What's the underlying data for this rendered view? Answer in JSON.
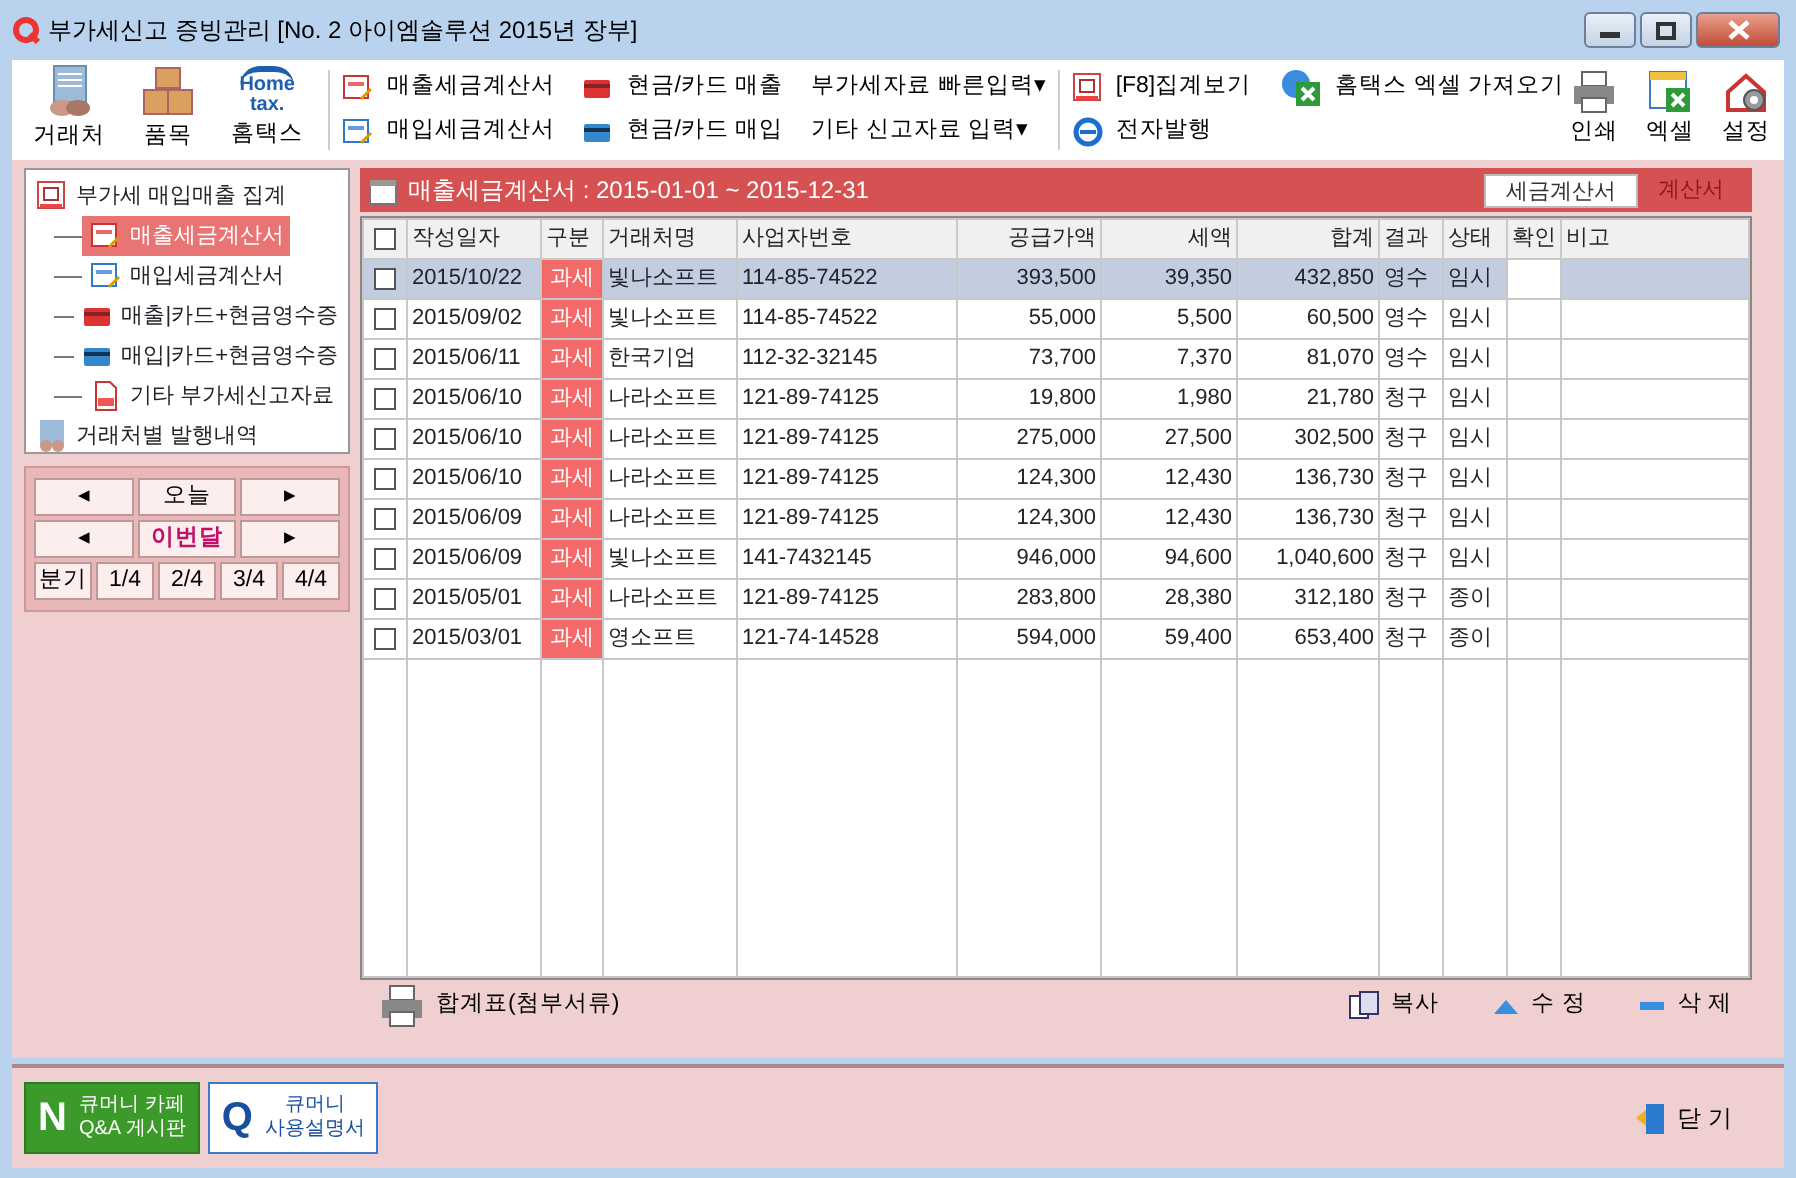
{
  "window": {
    "title": "부가세신고 증빙관리 [No. 2 아이엠솔루션 2015년 장부]"
  },
  "toolbar": {
    "big_buttons": [
      {
        "label": "거래처",
        "kind": "people"
      },
      {
        "label": "품목",
        "kind": "boxes"
      },
      {
        "label": "홈택스",
        "kind": "hometax"
      }
    ],
    "hometax_logo": [
      "Home",
      "tax."
    ],
    "links": [
      {
        "label": "매출세금계산서",
        "kind": "sales"
      },
      {
        "label": "매입세금계산서",
        "kind": "purchase"
      },
      {
        "label": "현금/카드 매출",
        "kind": "cardsales"
      },
      {
        "label": "현금/카드 매입",
        "kind": "cardpurchase"
      },
      {
        "label": "부가세자료 빠른입력▾",
        "kind": "none"
      },
      {
        "label": "기타 신고자료 입력▾",
        "kind": "none"
      },
      {
        "label": "[F8]집계보기",
        "kind": "sum"
      },
      {
        "label": "전자발행",
        "kind": "e"
      },
      {
        "label": "홈택스 엑셀 가져오기",
        "kind": "excelimport"
      }
    ],
    "right_buttons": [
      {
        "label": "인쇄",
        "kind": "print"
      },
      {
        "label": "엑셀",
        "kind": "excel"
      },
      {
        "label": "설정",
        "kind": "settings"
      }
    ]
  },
  "sidebar": {
    "tree": [
      {
        "label": "부가세 매입매출 집계",
        "kind": "sum",
        "selected": false,
        "children": [
          {
            "label": "매출세금계산서",
            "kind": "sales",
            "selected": true
          },
          {
            "label": "매입세금계산서",
            "kind": "purchase",
            "selected": false
          },
          {
            "label": "매출|카드+현금영수증",
            "kind": "cardsales",
            "selected": false
          },
          {
            "label": "매입|카드+현금영수증",
            "kind": "cardpurchase",
            "selected": false
          },
          {
            "label": "기타 부가세신고자료",
            "kind": "tax",
            "selected": false
          }
        ]
      },
      {
        "label": "거래처별 발행내역",
        "kind": "people",
        "selected": false
      }
    ],
    "date_nav": [
      [
        "◂",
        "오늘",
        "▸"
      ],
      [
        "◂",
        "이번달",
        "▸"
      ],
      [
        "분기",
        "1/4",
        "2/4",
        "3/4",
        "4/4"
      ]
    ]
  },
  "panel": {
    "title": "매출세금계산서 : 2015-01-01 ~ 2015-12-31",
    "tabs": [
      {
        "label": "세금계산서",
        "selected": true
      },
      {
        "label": "계산서",
        "selected": false
      }
    ]
  },
  "table": {
    "header_checked": false,
    "columns": [
      "작성일자",
      "구분",
      "거래처명",
      "사업자번호",
      "공급가액",
      "세액",
      "합계",
      "결과",
      "상태",
      "확인",
      "비고"
    ],
    "rows": [
      {
        "selected": true,
        "checked": false,
        "cells": [
          "2015/10/22",
          "과세",
          "빛나소프트",
          "114-85-74522",
          "393,500",
          "39,350",
          "432,850",
          "영수",
          "임시",
          "",
          ""
        ]
      },
      {
        "selected": false,
        "checked": false,
        "cells": [
          "2015/09/02",
          "과세",
          "빛나소프트",
          "114-85-74522",
          "55,000",
          "5,500",
          "60,500",
          "영수",
          "임시",
          "",
          ""
        ]
      },
      {
        "selected": false,
        "checked": false,
        "cells": [
          "2015/06/11",
          "과세",
          "한국기업",
          "112-32-32145",
          "73,700",
          "7,370",
          "81,070",
          "영수",
          "임시",
          "",
          ""
        ]
      },
      {
        "selected": false,
        "checked": false,
        "cells": [
          "2015/06/10",
          "과세",
          "나라소프트",
          "121-89-74125",
          "19,800",
          "1,980",
          "21,780",
          "청구",
          "임시",
          "",
          ""
        ]
      },
      {
        "selected": false,
        "checked": false,
        "cells": [
          "2015/06/10",
          "과세",
          "나라소프트",
          "121-89-74125",
          "275,000",
          "27,500",
          "302,500",
          "청구",
          "임시",
          "",
          ""
        ]
      },
      {
        "selected": false,
        "checked": false,
        "cells": [
          "2015/06/10",
          "과세",
          "나라소프트",
          "121-89-74125",
          "124,300",
          "12,430",
          "136,730",
          "청구",
          "임시",
          "",
          ""
        ]
      },
      {
        "selected": false,
        "checked": false,
        "cells": [
          "2015/06/09",
          "과세",
          "나라소프트",
          "121-89-74125",
          "124,300",
          "12,430",
          "136,730",
          "청구",
          "임시",
          "",
          ""
        ]
      },
      {
        "selected": false,
        "checked": false,
        "cells": [
          "2015/06/09",
          "과세",
          "빛나소프트",
          "141-7432145",
          "946,000",
          "94,600",
          "1,040,600",
          "청구",
          "임시",
          "",
          ""
        ]
      },
      {
        "selected": false,
        "checked": false,
        "cells": [
          "2015/05/01",
          "과세",
          "나라소프트",
          "121-89-74125",
          "283,800",
          "28,380",
          "312,180",
          "청구",
          "종이",
          "",
          ""
        ]
      },
      {
        "selected": false,
        "checked": false,
        "cells": [
          "2015/03/01",
          "과세",
          "영소프트",
          "121-74-14528",
          "594,000",
          "59,400",
          "653,400",
          "청구",
          "종이",
          "",
          ""
        ]
      }
    ]
  },
  "footer_actions": [
    {
      "label": "합계표(첨부서류)",
      "kind": "print"
    },
    {
      "label": "복사",
      "kind": "copy"
    },
    {
      "label": "수 정",
      "kind": "edit"
    },
    {
      "label": "삭 제",
      "kind": "delete"
    }
  ],
  "bottom": {
    "cafe_button": {
      "letter": "N",
      "lines": [
        "큐머니 카페",
        "Q&A 게시판"
      ]
    },
    "manual_button": {
      "letter": "Q",
      "lines": [
        "큐머니",
        "사용설명서"
      ]
    },
    "close_button": "닫 기"
  }
}
